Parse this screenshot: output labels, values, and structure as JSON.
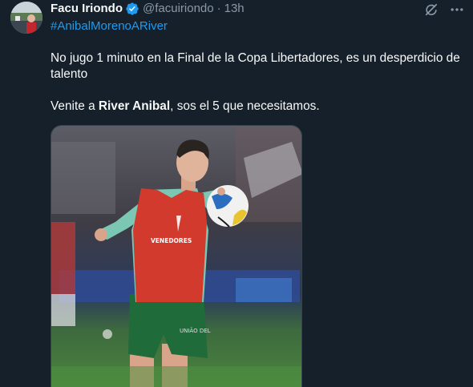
{
  "tweet": {
    "author": {
      "display_name": "Facu Iriondo",
      "handle": "@facuiriondo",
      "verified_icon": "verified-badge-icon",
      "avatar_icon": "avatar"
    },
    "separator": "·",
    "time": "13h",
    "hashtag": "#AnibalMorenoARiver",
    "text": {
      "line1": "No jugo 1 minuto en la Final de la Copa Libertadores, es un desperdicio de talento",
      "line2_prefix": "Venite a ",
      "line2_bold": "River Anibal",
      "line2_suffix": ", sos el 5 que necesitamos."
    },
    "media": {
      "vest_text": "VENEDORES",
      "shorts_text": "UNIÃO DEL"
    },
    "icons": {
      "grok": "grok-icon",
      "more": "more-options-icon"
    },
    "colors": {
      "background": "#15202b",
      "link": "#1d9bf0",
      "secondary_text": "#8b98a5",
      "primary_text": "#f7f9f9",
      "verified": "#1d9bf0"
    }
  }
}
